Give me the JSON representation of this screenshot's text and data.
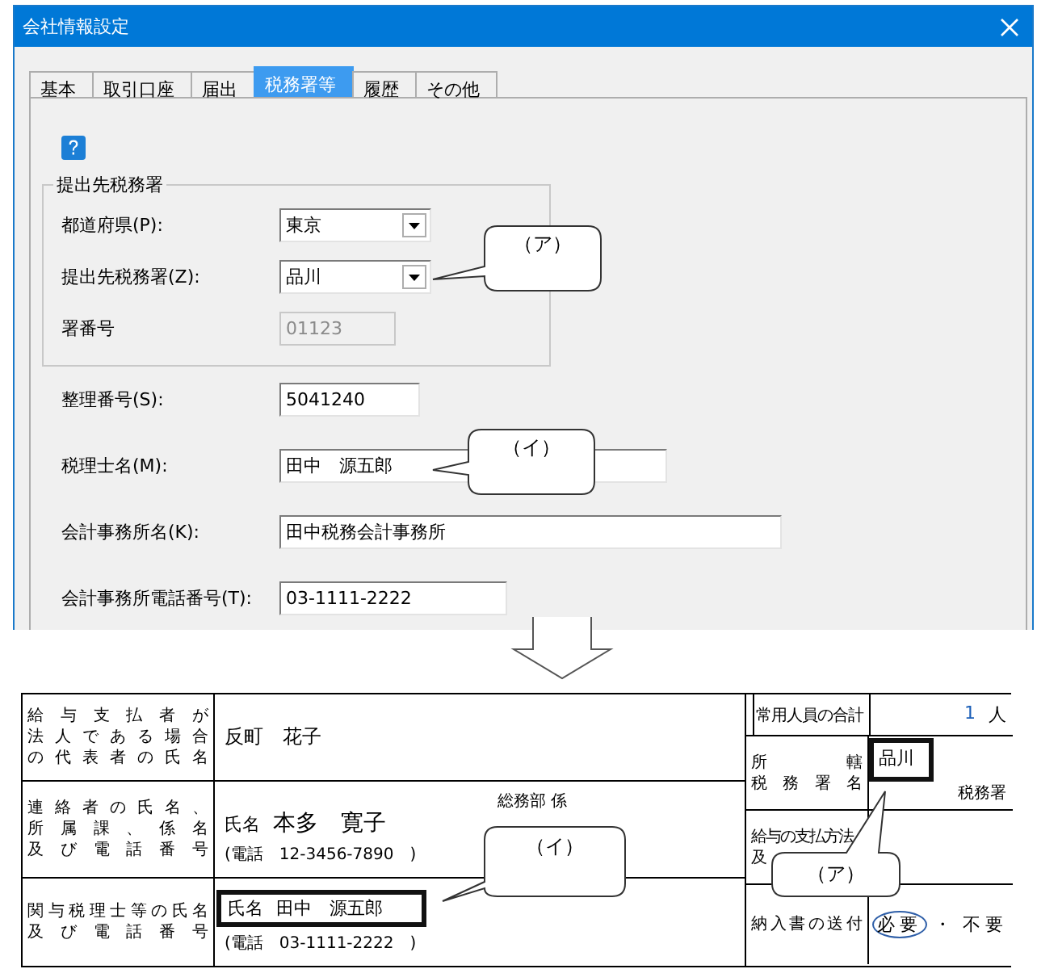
{
  "window": {
    "title": "会社情報設定"
  },
  "tabs": [
    {
      "label": "基本",
      "selected": false
    },
    {
      "label": "取引口座",
      "selected": false
    },
    {
      "label": "届出",
      "selected": false
    },
    {
      "label": "税務署等",
      "selected": true
    },
    {
      "label": "履歴",
      "selected": false
    },
    {
      "label": "その他",
      "selected": false
    }
  ],
  "group": {
    "title": "提出先税務署",
    "fields": [
      {
        "label": "都道府県(P):",
        "kind": "combo",
        "value": "東京"
      },
      {
        "label": "提出先税務署(Z):",
        "kind": "combo",
        "value": "品川"
      },
      {
        "label": "署番号",
        "kind": "text",
        "value": "01123",
        "disabled": true
      }
    ]
  },
  "fields": [
    {
      "label": "整理番号(S):",
      "kind": "text",
      "value": "5041240",
      "disabled": false
    },
    {
      "label": "税理士名(M):",
      "kind": "text",
      "value": "田中　源五郎",
      "disabled": false
    },
    {
      "label": "会計事務所名(K):",
      "kind": "text",
      "value": "田中税務会計事務所",
      "disabled": false
    },
    {
      "label": "会計事務所電話番号(T):",
      "kind": "text",
      "value": "03-1111-2222",
      "disabled": false
    }
  ],
  "dialog_callouts": [
    {
      "text": "（ア）"
    },
    {
      "text": "（イ）"
    }
  ],
  "form": {
    "left_rows": [
      {
        "kind": "name",
        "label_lines": [
          "給与支払者が",
          "法人である場合",
          "の代表者の氏名"
        ],
        "value": "反町　花子"
      },
      {
        "kind": "contact",
        "label_lines": [
          "連絡者の氏名、",
          "所属課、係名",
          "及び電話番号"
        ],
        "department": "総務部 係",
        "name_label": "氏名",
        "name": "本多　寛子",
        "phone": "(電話　12-3456-7890　)"
      },
      {
        "kind": "accountant",
        "label_lines": [
          "関与税理士等の氏名",
          "及び電話番号"
        ],
        "name_label": "氏名",
        "name": "田中　源五郎",
        "phone": "(電話　03-1111-2222　)",
        "highlighted": true
      }
    ],
    "right_rows": [
      {
        "kind": "count",
        "label": "常用人員の合計",
        "value": "1",
        "unit": "人"
      },
      {
        "kind": "office",
        "label_lines": [
          "所　　　轄",
          "税務署名"
        ],
        "value": "品川",
        "suffix": "税務署",
        "highlighted": true
      },
      {
        "kind": "payment",
        "label_lines": [
          "給与の支払方法",
          "及"
        ]
      },
      {
        "kind": "choice",
        "label": "納入書の送付",
        "options": [
          {
            "label": "必要",
            "selected": true
          },
          {
            "label": "不要",
            "selected": false
          }
        ],
        "separator": "・"
      }
    ],
    "callouts": [
      {
        "text": "（イ）"
      },
      {
        "text": "（ア）"
      }
    ]
  }
}
